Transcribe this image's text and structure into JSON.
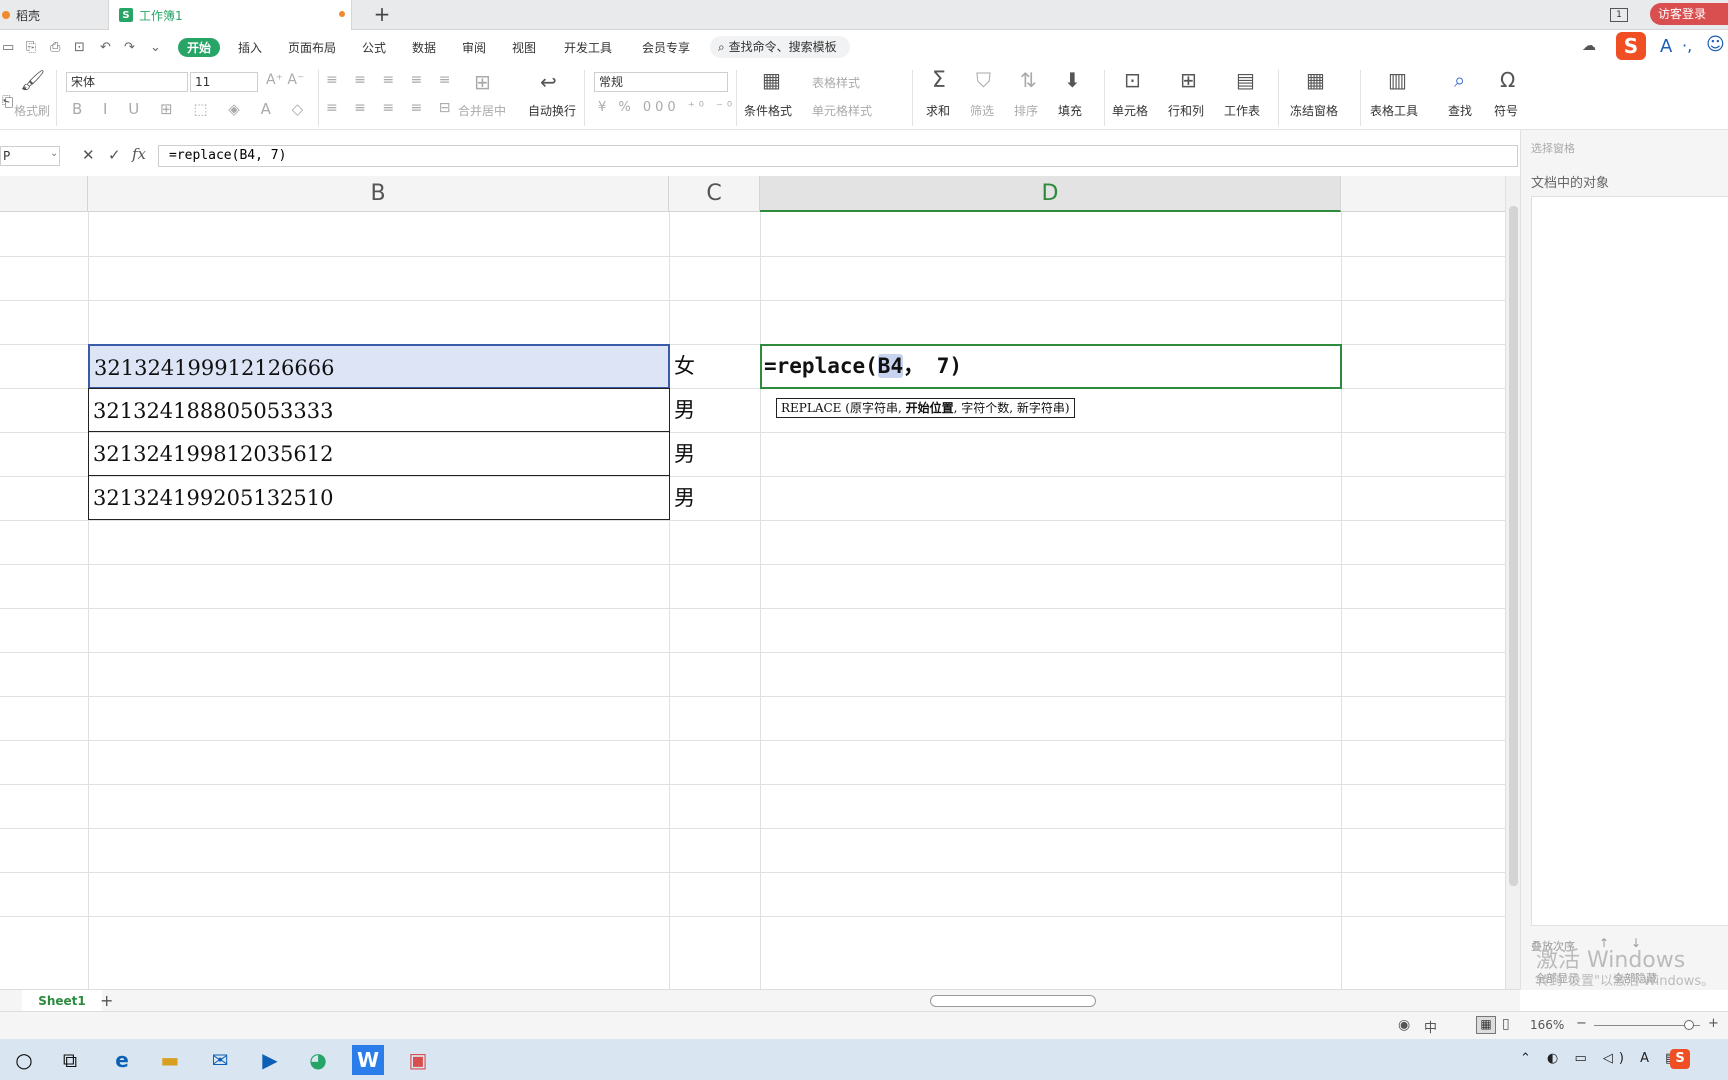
{
  "tabs": {
    "inactive": "稻壳",
    "active": "工作簿1",
    "new_tab": "+",
    "window_count": "1",
    "login": "访客登录"
  },
  "menubar": {
    "items": [
      "开始",
      "插入",
      "页面布局",
      "公式",
      "数据",
      "审阅",
      "视图",
      "开发工具",
      "会员专享"
    ],
    "search_placeholder": "查找命令、搜索模板"
  },
  "ribbon": {
    "format_painter": "格式刷",
    "font_name": "宋体",
    "font_size": "11",
    "number_format": "常规",
    "merge_center": "合并居中",
    "wrap_text": "自动换行",
    "cond_format": "条件格式",
    "table_style": "表格样式",
    "cell_style": "单元格样式",
    "sum": "求和",
    "filter": "筛选",
    "sort": "排序",
    "fill": "填充",
    "cell": "单元格",
    "row_col": "行和列",
    "worksheet": "工作表",
    "freeze": "冻结窗格",
    "table_tools": "表格工具",
    "find": "查找",
    "symbol": "符号"
  },
  "formula_bar": {
    "name_box": "P",
    "formula": "=replace(B4, 7)"
  },
  "sheet": {
    "columns": [
      "B",
      "C",
      "D"
    ],
    "rows": [
      {
        "id": "321324199912126666",
        "gender": "女"
      },
      {
        "id": "321324188805053333",
        "gender": "男"
      },
      {
        "id": "321324199812035612",
        "gender": "男"
      },
      {
        "id": "321324199205132510",
        "gender": "男"
      }
    ],
    "active_cell": {
      "prefix": "=replace(",
      "ref": "B4",
      "suffix": "， 7)"
    },
    "tooltip": {
      "fn": "REPLACE (原字符串, ",
      "bold": "开始位置",
      "rest": ", 字符个数, 新字符串)"
    }
  },
  "right_panel": {
    "title": "选择窗格",
    "objects": "文档中的对象",
    "stack_order": "叠放次序",
    "show_all": "全部显示",
    "hide_all": "全部隐藏"
  },
  "sheet_tabs": {
    "sheet1": "Sheet1",
    "add": "+"
  },
  "status": {
    "zoom": "166%",
    "lang": "中"
  },
  "watermark": {
    "line1": "激活 Windows",
    "line2": "转到\"设置\"以激活 Windows。"
  },
  "colors": {
    "accent": "#27a567",
    "selection_border": "#2e8b3e"
  }
}
